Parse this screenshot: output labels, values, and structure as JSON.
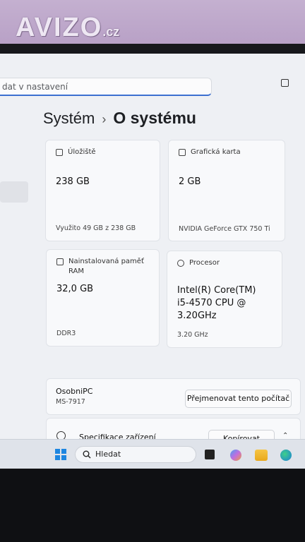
{
  "watermark": {
    "brand": "AVIZO",
    "tld": ".cz"
  },
  "window": {
    "search_placeholder": "dat v nastavení"
  },
  "breadcrumb": {
    "parent": "Systém",
    "separator": "›",
    "current": "O systému"
  },
  "cards": {
    "storage": {
      "title": "Úložiště",
      "value": "238 GB",
      "detail": "Využito 49 GB z 238 GB",
      "icon": "storage-icon"
    },
    "graphics": {
      "title": "Grafická karta",
      "value": "2 GB",
      "detail": "NVIDIA GeForce GTX 750 Ti",
      "icon": "graphics-card-icon"
    },
    "ram": {
      "title_line1": "Nainstalovaná paměť",
      "title_line2": "RAM",
      "value": "32,0 GB",
      "detail": "DDR3",
      "icon": "memory-icon"
    },
    "cpu": {
      "title": "Procesor",
      "value_line1": "Intel(R) Core(TM)",
      "value_line2": "i5-4570 CPU @",
      "value_line3": "3.20GHz",
      "detail": "3.20 GHz",
      "icon": "processor-icon"
    }
  },
  "device": {
    "name": "OsobniPC",
    "model": "MS-7917",
    "rename_button": "Přejmenovat tento počítač"
  },
  "specs": {
    "title": "Specifikace zařízení",
    "copy_button": "Kopírovat"
  },
  "taskbar": {
    "search_label": "Hledat",
    "icons": [
      "windows-start-icon",
      "search-icon",
      "task-view-icon",
      "copilot-icon",
      "file-explorer-icon",
      "edge-icon"
    ]
  },
  "colors": {
    "accent": "#3b6fd0",
    "screen_bg": "#eef0f4",
    "card_bg": "#f8f9fb",
    "taskbar_bg": "#dfe3ea",
    "watermark_bg": "#c4b0d0"
  }
}
